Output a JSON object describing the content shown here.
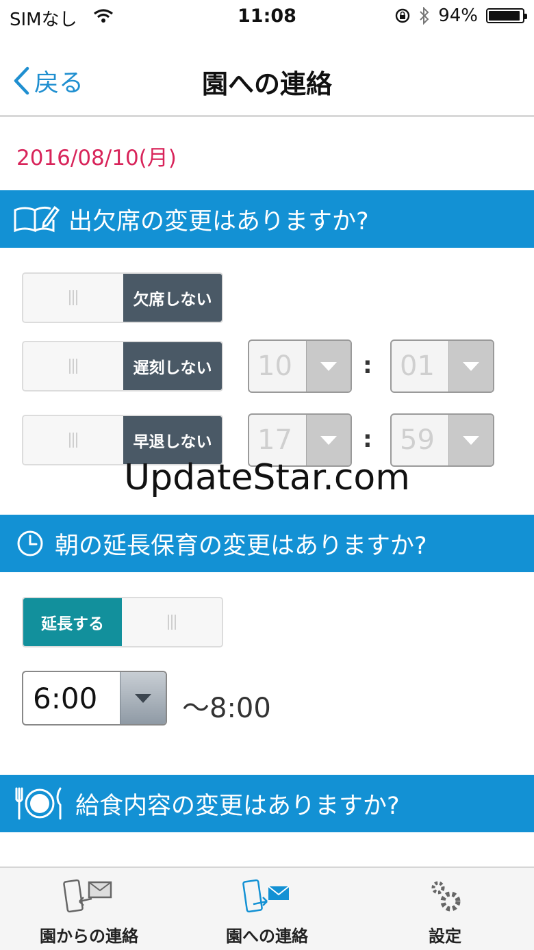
{
  "status_bar": {
    "carrier": "SIMなし",
    "time": "11:08",
    "battery": "94%",
    "battery_level": 0.94,
    "icons": [
      "wifi-icon",
      "rotation-lock-icon",
      "bluetooth-icon",
      "battery-icon"
    ]
  },
  "nav": {
    "back_label": "戻る",
    "title": "園への連絡"
  },
  "date": "2016/08/10(月)",
  "attendance": {
    "header": "出欠席の変更はありますか?",
    "icon": "book-pencil-icon",
    "absence_label": "欠席しない",
    "late_label": "遅刻しない",
    "late_hour": "10",
    "late_minute": "01",
    "early_label": "早退しない",
    "early_hour": "17",
    "early_minute": "59",
    "separator": ":"
  },
  "watermark": "UpdateStar.com",
  "morning_care": {
    "header": "朝の延長保育の変更はありますか?",
    "icon": "clock-icon",
    "extend_label": "延長する",
    "start_time": "6:00",
    "end_time": "〜8:00"
  },
  "lunch": {
    "header": "給食内容の変更はありますか?",
    "icon": "plate-cutlery-icon"
  },
  "tabs": [
    {
      "label": "園からの連絡",
      "icon": "phone-receive-mail-icon",
      "active": false
    },
    {
      "label": "園への連絡",
      "icon": "phone-send-mail-icon",
      "active": true
    },
    {
      "label": "設定",
      "icon": "gear-icon",
      "active": false
    }
  ],
  "colors": {
    "accent_blue": "#1391d4",
    "date_red": "#d8245a",
    "toggle_dark": "#4a5966",
    "toggle_teal": "#12909c"
  }
}
